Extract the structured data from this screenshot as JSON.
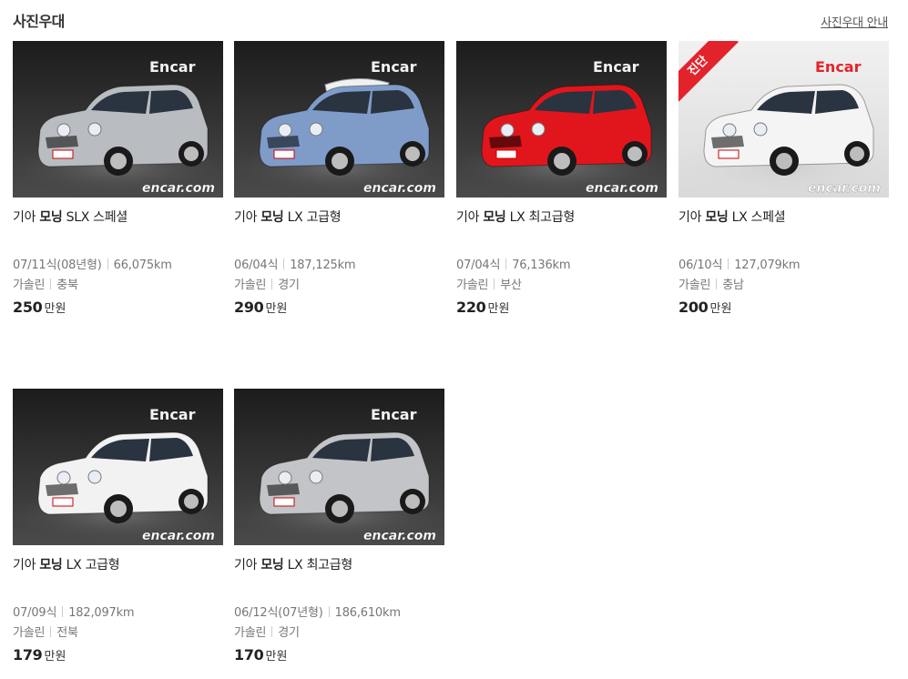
{
  "header": {
    "title": "사진우대",
    "guide_link": "사진우대 안내"
  },
  "listings": [
    {
      "make": "기아",
      "model": "모닝",
      "trim": "SLX 스페셜",
      "year": "07/11식(08년형)",
      "mileage": "66,075km",
      "fuel": "가솔린",
      "region": "충북",
      "price": "250",
      "price_unit": "만원",
      "photo": "silver-car-photo",
      "body_color": "#b9bcc0",
      "watermark": "encar.com",
      "logo": "Encar",
      "badge": ""
    },
    {
      "make": "기아",
      "model": "모닝",
      "trim": "LX 고급형",
      "year": "06/04식",
      "mileage": "187,125km",
      "fuel": "가솔린",
      "region": "경기",
      "price": "290",
      "price_unit": "만원",
      "photo": "blue-car-photo",
      "body_color": "#7f9cc9",
      "watermark": "encar.com",
      "logo": "Encar",
      "badge": ""
    },
    {
      "make": "기아",
      "model": "모닝",
      "trim": "LX 최고급형",
      "year": "07/04식",
      "mileage": "76,136km",
      "fuel": "가솔린",
      "region": "부산",
      "price": "220",
      "price_unit": "만원",
      "photo": "red-car-photo",
      "body_color": "#e1161c",
      "watermark": "encar.com",
      "logo": "Encar",
      "badge": ""
    },
    {
      "make": "기아",
      "model": "모닝",
      "trim": "LX 스페셜",
      "year": "06/10식",
      "mileage": "127,079km",
      "fuel": "가솔린",
      "region": "충남",
      "price": "200",
      "price_unit": "만원",
      "photo": "white-car-photo",
      "body_color": "#f4f4f4",
      "watermark": "encar.com",
      "logo": "Encar",
      "badge": "진단"
    },
    {
      "make": "기아",
      "model": "모닝",
      "trim": "LX 고급형",
      "year": "07/09식",
      "mileage": "182,097km",
      "fuel": "가솔린",
      "region": "전북",
      "price": "179",
      "price_unit": "만원",
      "photo": "white-car-photo",
      "body_color": "#f2f2f2",
      "watermark": "encar.com",
      "logo": "Encar",
      "badge": ""
    },
    {
      "make": "기아",
      "model": "모닝",
      "trim": "LX 최고급형",
      "year": "06/12식(07년형)",
      "mileage": "186,610km",
      "fuel": "가솔린",
      "region": "경기",
      "price": "170",
      "price_unit": "만원",
      "photo": "silver-car-photo",
      "body_color": "#c2c4c8",
      "watermark": "encar.com",
      "logo": "Encar",
      "badge": ""
    }
  ]
}
